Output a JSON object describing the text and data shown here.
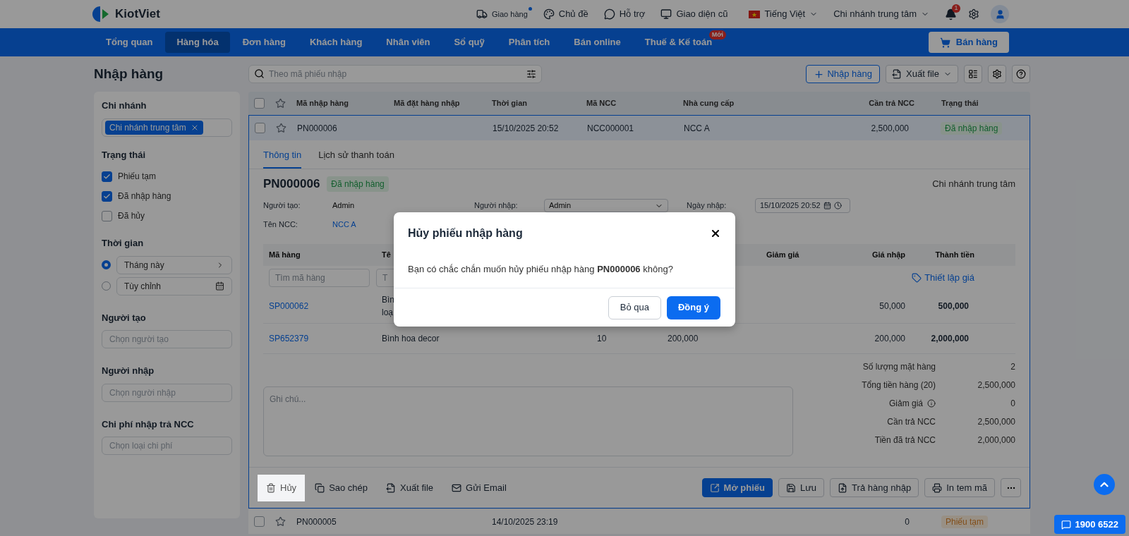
{
  "header": {
    "logo": "KiotViet",
    "links": [
      {
        "label": "Giao hàng",
        "dot": true
      },
      {
        "label": "Chủ đề",
        "dot": false
      },
      {
        "label": "Hỗ trợ",
        "dot": false
      },
      {
        "label": "Giao diện cũ",
        "dot": false
      }
    ],
    "language": "Tiếng Việt",
    "branch": "Chi nhánh trung tâm",
    "notification_count": "1"
  },
  "nav": {
    "items": [
      {
        "label": "Tổng quan",
        "selected": false
      },
      {
        "label": "Hàng hóa",
        "selected": true
      },
      {
        "label": "Đơn hàng",
        "selected": false
      },
      {
        "label": "Khách hàng",
        "selected": false
      },
      {
        "label": "Nhân viên",
        "selected": false
      },
      {
        "label": "Sổ quỹ",
        "selected": false
      },
      {
        "label": "Phân tích",
        "selected": false
      },
      {
        "label": "Bán online",
        "selected": false
      },
      {
        "label": "Thuế & Kế toán",
        "selected": false,
        "badge": "Mới"
      }
    ],
    "sell_button": "Bán hàng"
  },
  "page_title": "Nhập hàng",
  "filters": {
    "branch": {
      "label": "Chi nhánh",
      "tag": "Chi nhánh trung tâm"
    },
    "status": {
      "label": "Trạng thái",
      "options": [
        {
          "label": "Phiếu tạm",
          "checked": true
        },
        {
          "label": "Đã nhập hàng",
          "checked": true
        },
        {
          "label": "Đã hủy",
          "checked": false
        }
      ]
    },
    "time": {
      "label": "Thời gian",
      "options": [
        {
          "label": "Tháng này",
          "selected": true,
          "kind": "preset"
        },
        {
          "label": "Tùy chỉnh",
          "selected": false,
          "kind": "custom"
        }
      ]
    },
    "selects": [
      {
        "label": "Người tạo",
        "placeholder": "Chọn người tạo"
      },
      {
        "label": "Người nhập",
        "placeholder": "Chọn người nhập"
      },
      {
        "label": "Chi phí nhập trả NCC",
        "placeholder": "Chọn loại chi phí"
      }
    ]
  },
  "toolbar": {
    "search_placeholder": "Theo mã phiếu nhập",
    "import_button": "Nhập hàng",
    "export_button": "Xuất file"
  },
  "table": {
    "all_checked": false,
    "columns": [
      "Mã nhập hàng",
      "Mã đặt hàng nhập",
      "Thời gian",
      "Mã NCC",
      "Nhà cung cấp",
      "Cần trả NCC",
      "Trạng thái"
    ],
    "rows": [
      {
        "code": "PN000006",
        "time": "15/10/2025 20:52",
        "supplier_code": "NCC000001",
        "supplier": "NCC A",
        "amount": "2,500,000",
        "status": {
          "label": "Đã nhập hàng",
          "kind": "done"
        },
        "expanded": true,
        "checked": false
      },
      {
        "code": "PN000005",
        "time": "14/10/2025 23:19",
        "amount": "0",
        "status": {
          "label": "Phiếu tạm",
          "kind": "draft"
        },
        "expanded": false,
        "checked": false
      }
    ]
  },
  "detail": {
    "tabs": [
      {
        "label": "Thông tin",
        "selected": true
      },
      {
        "label": "Lịch sử thanh toán",
        "selected": false
      }
    ],
    "code": "PN000006",
    "status": {
      "label": "Đã nhập hàng",
      "kind": "done"
    },
    "branch": "Chi nhánh trung tâm",
    "creator": {
      "label": "Người tạo:",
      "value": "Admin"
    },
    "importer": {
      "label": "Người nhập:",
      "value": "Admin"
    },
    "date": {
      "label": "Ngày nhập:",
      "value": "15/10/2025 20:52"
    },
    "supplier": {
      "label": "Tên NCC:",
      "value": "NCC A"
    },
    "items": {
      "columns": {
        "code": "Mã hàng",
        "name": "Tê",
        "discount": "Giảm giá",
        "import_price": "Giá nhập",
        "total": "Thành tiền"
      },
      "code_placeholder": "Tìm mã hàng",
      "name_placeholder": "T",
      "price_link": "Thiết lập giá",
      "rows": [
        {
          "code": "SP000062",
          "name_lines": [
            "Bìn",
            "loạ"
          ],
          "import_price": "50,000",
          "total": "500,000"
        },
        {
          "code": "SP652379",
          "name_lines": [
            "Bình hoa decor"
          ],
          "quantity": "10",
          "unit_price": "200,000",
          "import_price": "200,000",
          "total": "2,000,000"
        }
      ]
    },
    "note_placeholder": "Ghi chú...",
    "summary": [
      {
        "label": "Số lượng mặt hàng",
        "value": "2",
        "info": false
      },
      {
        "label": "Tổng tiền hàng (20)",
        "value": "2,500,000",
        "info": false
      },
      {
        "label": "Giảm giá",
        "value": "0",
        "info": true
      },
      {
        "label": "Cần trả NCC",
        "value": "2,500,000",
        "info": false
      },
      {
        "label": "Tiền đã trả NCC",
        "value": "2,000,000",
        "info": false
      }
    ],
    "left_actions": [
      {
        "label": "Hủy",
        "highlighted": true
      },
      {
        "label": "Sao chép",
        "highlighted": false
      },
      {
        "label": "Xuất file",
        "highlighted": false
      },
      {
        "label": "Gửi Email",
        "highlighted": false
      }
    ],
    "right_actions": [
      {
        "label": "Mở phiếu",
        "kind": "primary"
      },
      {
        "label": "Lưu",
        "kind": "outline"
      },
      {
        "label": "Trả hàng nhập",
        "kind": "outline"
      },
      {
        "label": "In tem mã",
        "kind": "outline"
      }
    ]
  },
  "dialog": {
    "title": "Hủy phiếu nhập hàng",
    "message": "Bạn có chắc chắn muốn hủy phiếu nhập hàng **PN000006** không?",
    "cancel": "Bỏ qua",
    "confirm": "Đồng ý"
  },
  "hotline": "1900 6522"
}
